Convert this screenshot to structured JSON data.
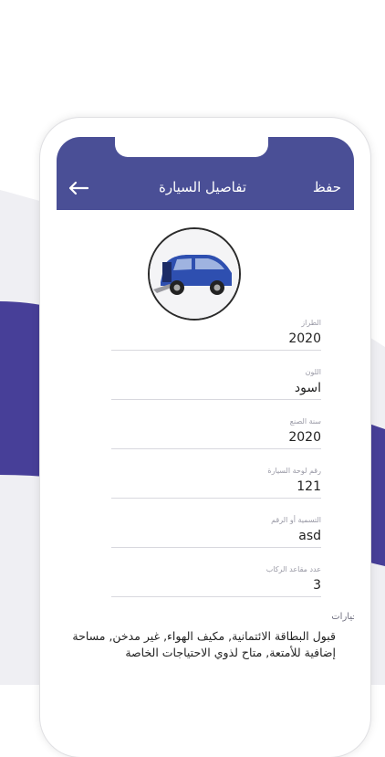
{
  "header": {
    "title": "تفاصيل السيارة",
    "save_label": "حفظ",
    "back_icon": "arrow-left-icon"
  },
  "colors": {
    "accent": "#4a4f96",
    "car_body": "#2e4fb0"
  },
  "car_photo_icon": "car-photo",
  "fields": [
    {
      "label": "الطراز",
      "value": "2020"
    },
    {
      "label": "اللون",
      "value": "اسود"
    },
    {
      "label": "سنة الصنع",
      "value": "2020"
    },
    {
      "label": "رقم لوحة السيارة",
      "value": "121"
    },
    {
      "label": "التسمية أو الرقم",
      "value": "asd"
    },
    {
      "label": "عدد مقاعد الركاب",
      "value": "3"
    }
  ],
  "options": {
    "label": "الخيارات:",
    "text": "قبول البطاقة الائتمانية, مكيف الهواء, غير مدخن, مساحة إضافية للأمتعة, متاح لذوي الاحتياجات الخاصة"
  }
}
